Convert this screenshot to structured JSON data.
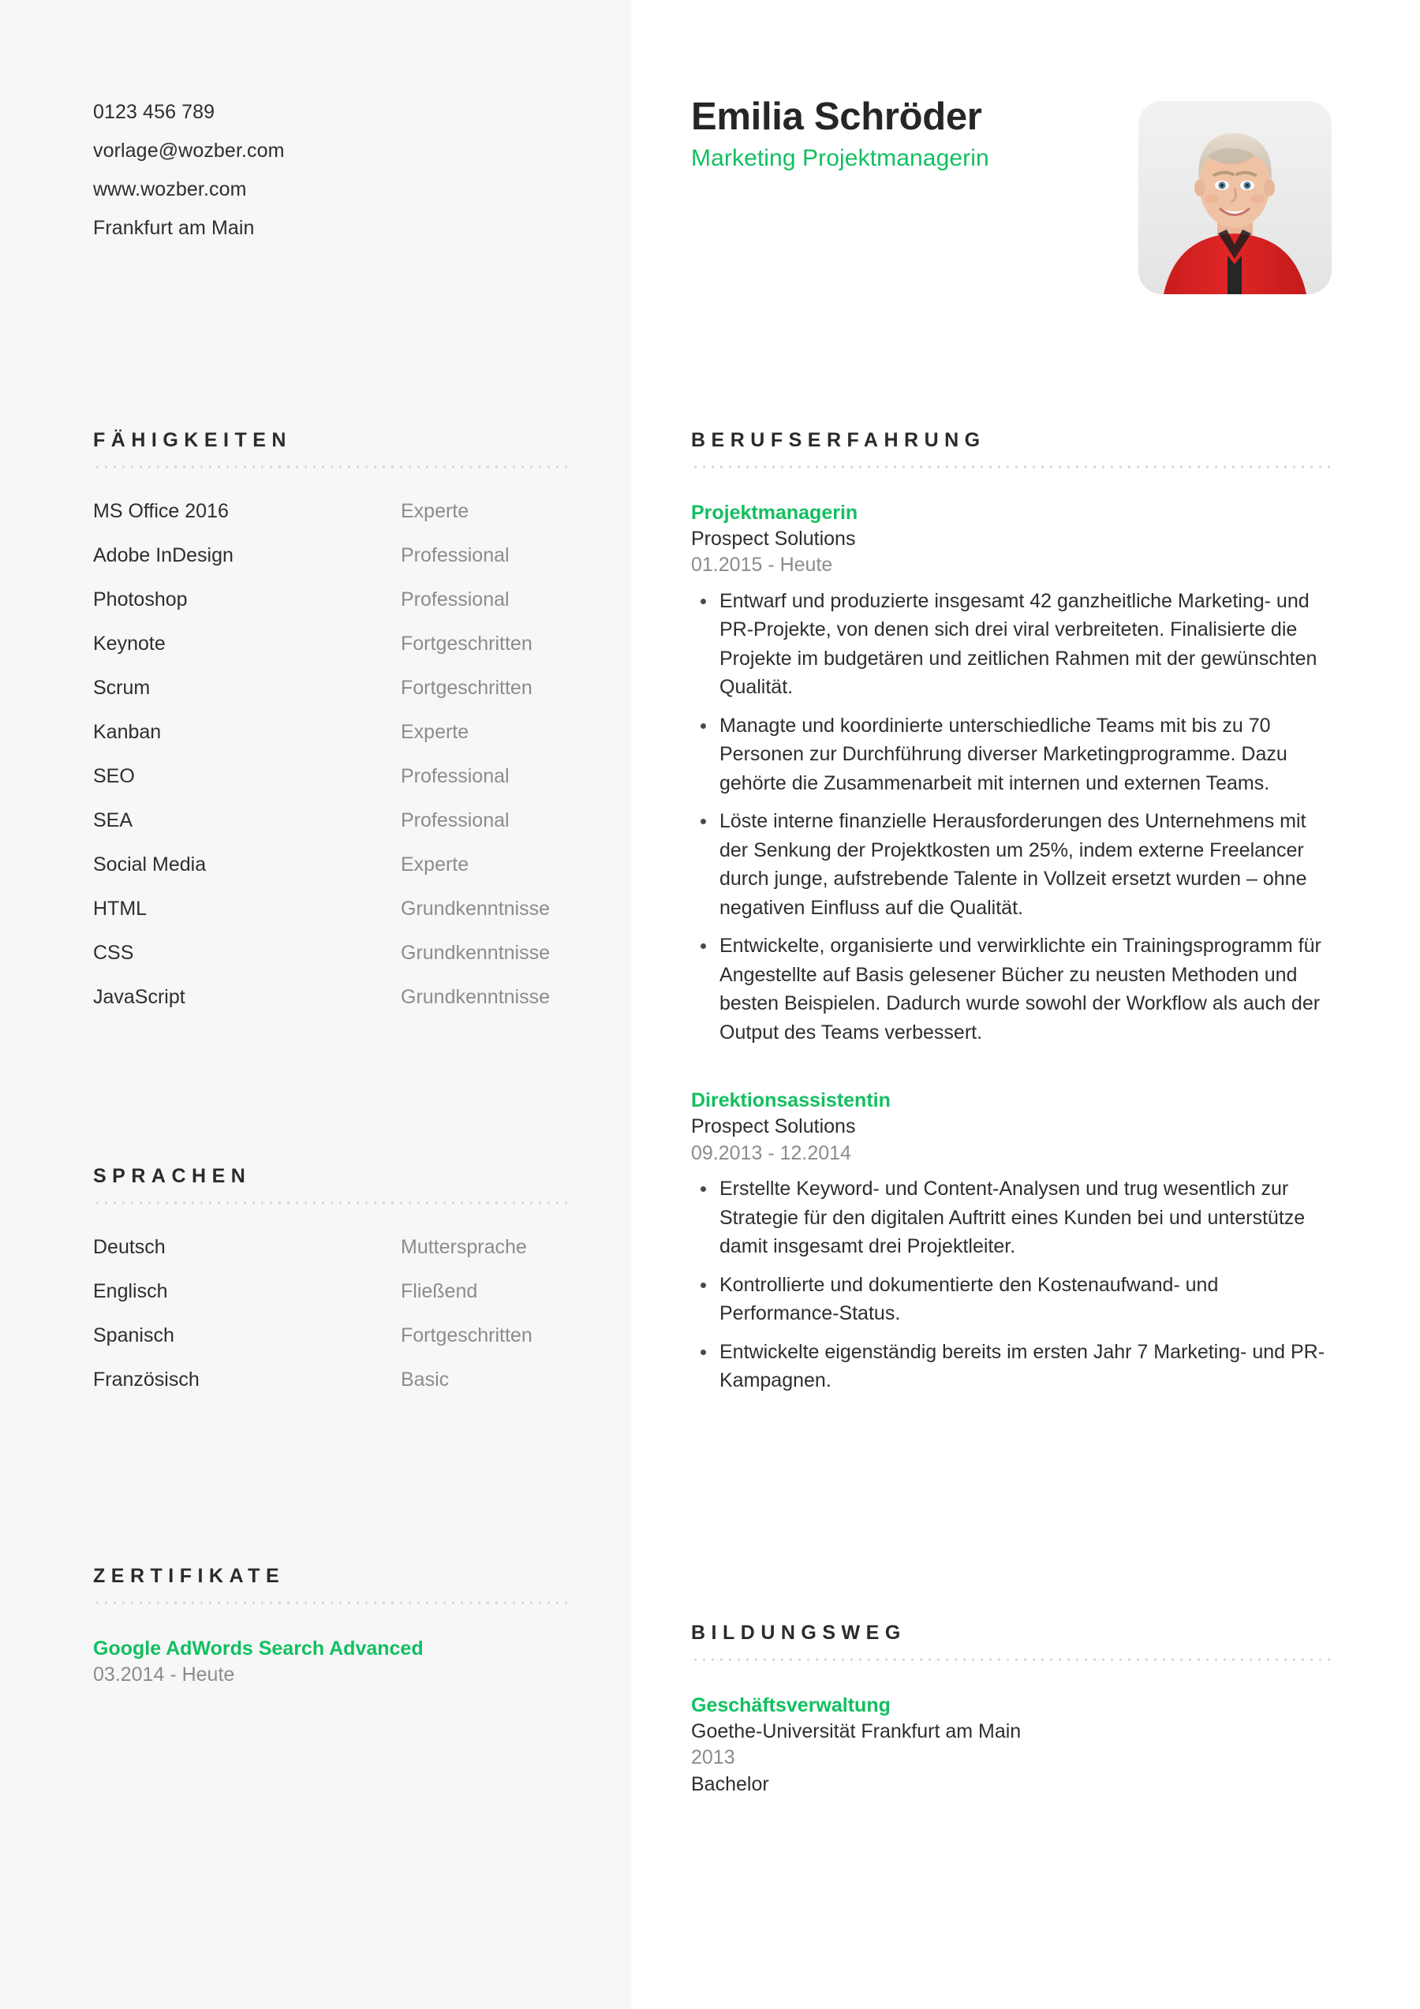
{
  "contact": {
    "phone": "0123 456 789",
    "email": "vorlage@wozber.com",
    "website": "www.wozber.com",
    "location": "Frankfurt am Main"
  },
  "header": {
    "name": "Emilia Schröder",
    "job_title": "Marketing Projektmanagerin",
    "photo_alt": "profile-photo"
  },
  "colors": {
    "accent_green": "#12bf60",
    "text_dark": "#2e2e2e",
    "text_muted": "#8c8c8c",
    "sidebar_bg": "#f7f7f8",
    "dot_rule": "#d2d2d2"
  },
  "sections": {
    "skills_title": "Fähigkeiten",
    "languages_title": "Sprachen",
    "certificates_title": "Zertifikate",
    "experience_title": "Berufserfahrung",
    "education_title": "Bildungsweg"
  },
  "skills": [
    {
      "name": "MS Office 2016",
      "level": "Experte"
    },
    {
      "name": "Adobe InDesign",
      "level": "Professional"
    },
    {
      "name": "Photoshop",
      "level": "Professional"
    },
    {
      "name": "Keynote",
      "level": "Fortgeschritten"
    },
    {
      "name": "Scrum",
      "level": "Fortgeschritten"
    },
    {
      "name": "Kanban",
      "level": "Experte"
    },
    {
      "name": "SEO",
      "level": "Professional"
    },
    {
      "name": "SEA",
      "level": "Professional"
    },
    {
      "name": "Social Media",
      "level": "Experte"
    },
    {
      "name": "HTML",
      "level": "Grundkenntnisse"
    },
    {
      "name": "CSS",
      "level": "Grundkenntnisse"
    },
    {
      "name": "JavaScript",
      "level": "Grundkenntnisse"
    }
  ],
  "languages": [
    {
      "name": "Deutsch",
      "level": "Muttersprache"
    },
    {
      "name": "Englisch",
      "level": "Fließend"
    },
    {
      "name": "Spanisch",
      "level": "Fortgeschritten"
    },
    {
      "name": "Französisch",
      "level": "Basic"
    }
  ],
  "certificates": [
    {
      "title": "Google AdWords Search Advanced",
      "date": "03.2014 - Heute"
    }
  ],
  "experience": [
    {
      "title": "Projektmanagerin",
      "company": "Prospect Solutions",
      "date": "01.2015 - Heute",
      "bullets": [
        "Entwarf und produzierte insgesamt 42 ganzheitliche Marketing- und PR-Projekte, von denen sich drei viral verbreiteten. Finalisierte die Projekte im budgetären und zeitlichen Rahmen mit der gewünschten Qualität.",
        "Managte und koordinierte unterschiedliche Teams mit bis zu 70 Personen zur Durchführung diverser Marketingprogramme. Dazu gehörte die Zusammenarbeit mit internen und externen Teams.",
        "Löste interne finanzielle Herausforderungen des Unternehmens mit der Senkung der Projektkosten um 25%, indem externe Freelancer durch junge, aufstrebende Talente in Vollzeit ersetzt wurden – ohne negativen Einfluss auf die Qualität.",
        "Entwickelte, organisierte und verwirklichte ein Trainingsprogramm für Angestellte auf Basis gelesener Bücher zu neusten Methoden und besten Beispielen. Dadurch wurde sowohl der Workflow als auch der Output des Teams verbessert."
      ]
    },
    {
      "title": "Direktionsassistentin",
      "company": "Prospect Solutions",
      "date": "09.2013 - 12.2014",
      "bullets": [
        "Erstellte Keyword- und Content-Analysen und trug wesentlich zur Strategie für den digitalen Auftritt eines Kunden bei und unterstütze damit insgesamt drei Projektleiter.",
        "Kontrollierte und dokumentierte den Kostenaufwand- und Performance-Status.",
        "Entwickelte eigenständig bereits im ersten Jahr 7 Marketing- und PR-Kampagnen."
      ]
    }
  ],
  "education": [
    {
      "program": "Geschäftsverwaltung",
      "school": "Goethe-Universität Frankfurt am Main",
      "date": "2013",
      "degree": "Bachelor"
    }
  ]
}
